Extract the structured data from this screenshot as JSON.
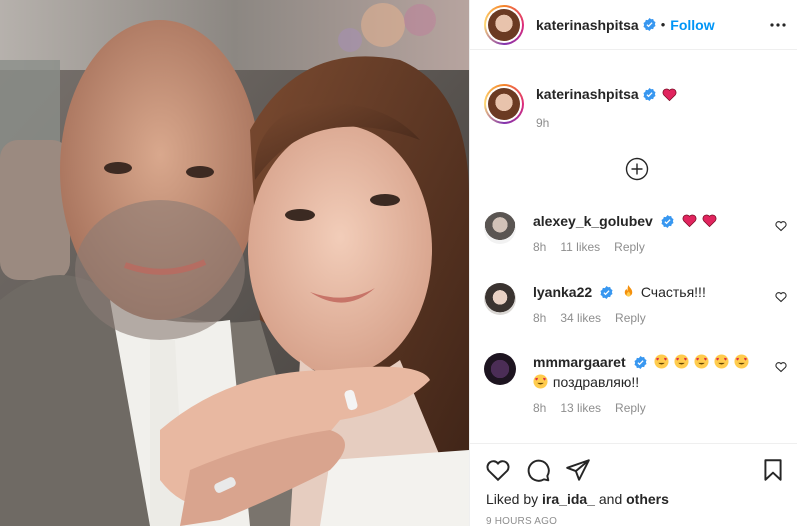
{
  "post": {
    "author": "katerinashpitsa",
    "follow_label": "Follow",
    "separator": "•",
    "caption_time": "9h",
    "liked_by_prefix": "Liked by",
    "liked_by_user": "ira_ida_",
    "liked_by_and": "and",
    "liked_by_others": "others",
    "timestamp": "9 HOURS AGO"
  },
  "comments": [
    {
      "user": "alexey_k_golubev",
      "text": "",
      "emoji": [
        "red-heart",
        "red-heart"
      ],
      "time": "8h",
      "likes": "11 likes",
      "reply": "Reply"
    },
    {
      "user": "lyanka22",
      "text": "Счастья!!!",
      "emoji_before": [
        "fire"
      ],
      "time": "8h",
      "likes": "34 likes",
      "reply": "Reply"
    },
    {
      "user": "mmmargaaret",
      "text": "поздравляю!!",
      "emoji": [
        "heart-eyes",
        "heart-eyes",
        "heart-eyes",
        "heart-eyes",
        "heart-eyes"
      ],
      "emoji_before_second_line": [
        "heart-eyes"
      ],
      "time": "8h",
      "likes": "13 likes",
      "reply": "Reply"
    }
  ],
  "icons": {
    "verified": "verified-badge-icon",
    "heart": "heart-outline-icon",
    "comment": "comment-bubble-icon",
    "share": "paper-plane-icon",
    "save": "bookmark-icon",
    "more": "more-horizontal-icon",
    "load_more": "plus-circle-icon"
  },
  "colors": {
    "accent": "#0095f6",
    "secondary_text": "#8e8e8e",
    "border": "#efefef",
    "heart_red": "#e0245e"
  }
}
